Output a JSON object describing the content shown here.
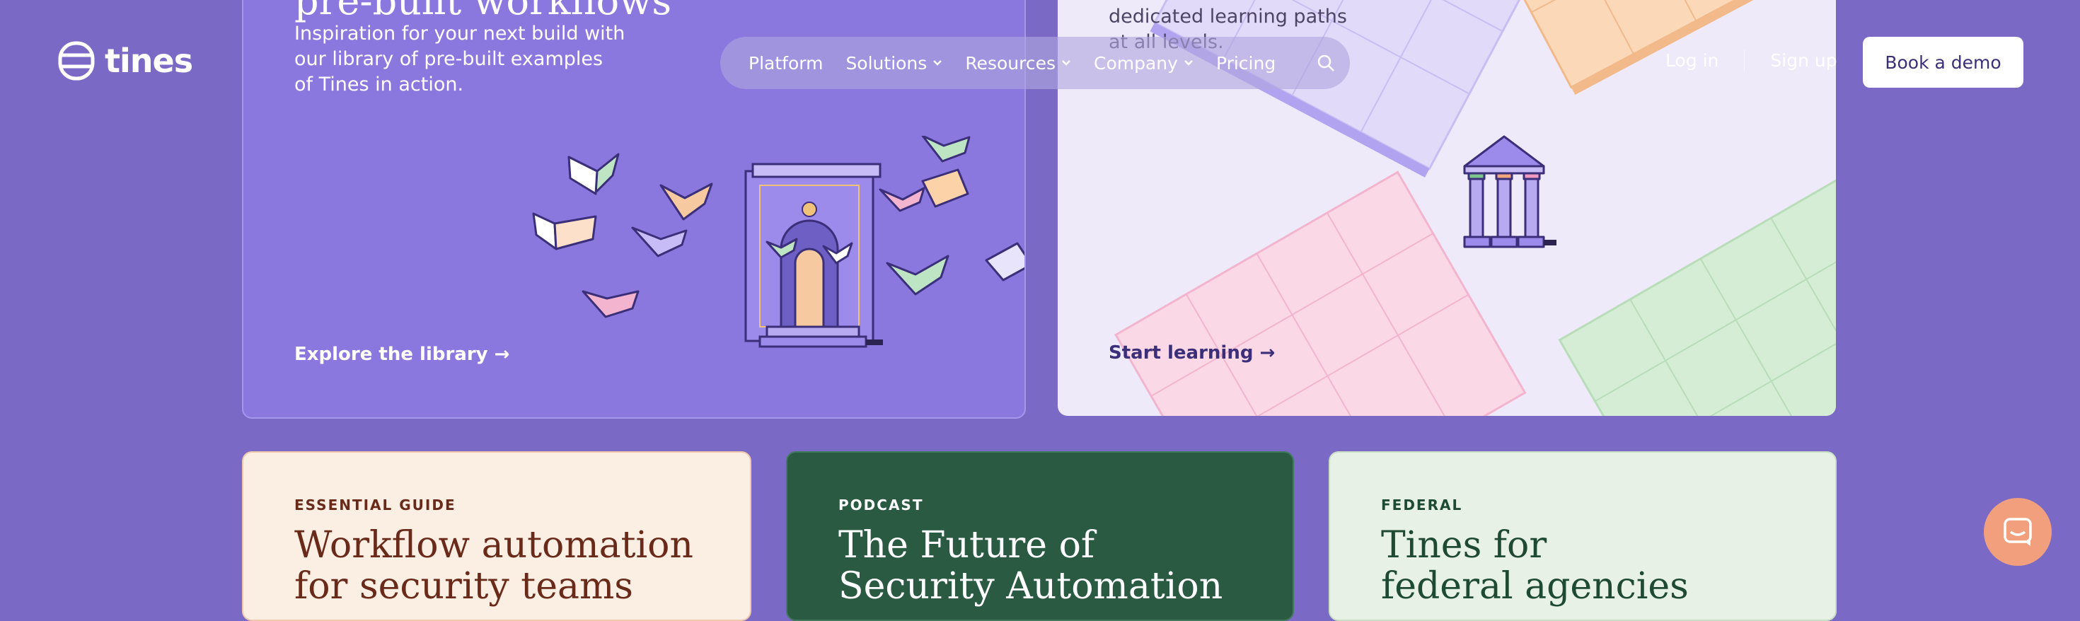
{
  "brand": {
    "logo_text": "tines"
  },
  "nav": {
    "items": [
      {
        "label": "Platform",
        "has_caret": false
      },
      {
        "label": "Solutions",
        "has_caret": true
      },
      {
        "label": "Resources",
        "has_caret": true
      },
      {
        "label": "Company",
        "has_caret": true
      },
      {
        "label": "Pricing",
        "has_caret": false
      }
    ],
    "search_icon": "search-icon",
    "login": "Log in",
    "signup": "Sign up",
    "demo": "Book a demo"
  },
  "library_card": {
    "heading": "pre-built workflows",
    "description": "Inspiration for your next build with our library of pre-built examples of Tines in action.",
    "link": "Explore the library →"
  },
  "learning_card": {
    "description_lines": [
      "dedicated learning paths",
      "at all levels."
    ],
    "link": "Start learning →"
  },
  "bottom_cards": [
    {
      "tag": "ESSENTIAL GUIDE",
      "title_lines": [
        "Workflow automation",
        "for security teams"
      ]
    },
    {
      "tag": "PODCAST",
      "title_lines": [
        "The Future of",
        "Security Automation"
      ]
    },
    {
      "tag": "FEDERAL",
      "title_lines": [
        "Tines for",
        "federal agencies"
      ]
    }
  ],
  "chat": {
    "icon": "chat-icon"
  },
  "colors": {
    "page_bg": "#7a6ac6",
    "library_card_bg": "#8a78df",
    "learning_card_bg": "#efeafa",
    "guide_card_bg": "#fbeee3",
    "podcast_card_bg": "#2a5a42",
    "federal_card_bg": "#e7f1e6",
    "chat_button": "#f19f7c"
  }
}
